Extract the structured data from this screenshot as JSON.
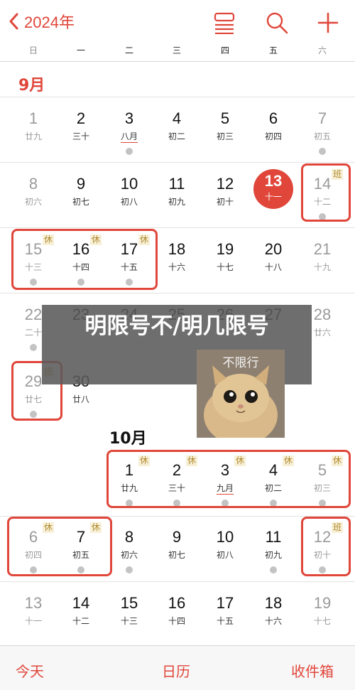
{
  "header": {
    "back_label": "2024年",
    "icons": [
      "list-view-icon",
      "search-icon",
      "add-icon"
    ]
  },
  "weekdays": [
    "日",
    "一",
    "二",
    "三",
    "四",
    "五",
    "六"
  ],
  "months": {
    "sep": {
      "label": "9月",
      "weeks": [
        [
          {
            "day": "1",
            "lunar": "廿九",
            "muted": true
          },
          {
            "day": "2",
            "lunar": "三十"
          },
          {
            "day": "3",
            "lunar": "八月",
            "underline": true,
            "dot": true
          },
          {
            "day": "4",
            "lunar": "初二"
          },
          {
            "day": "5",
            "lunar": "初三"
          },
          {
            "day": "6",
            "lunar": "初四"
          },
          {
            "day": "7",
            "lunar": "初五",
            "muted": true,
            "dot": true
          }
        ],
        [
          {
            "day": "8",
            "lunar": "初六",
            "muted": true
          },
          {
            "day": "9",
            "lunar": "初七"
          },
          {
            "day": "10",
            "lunar": "初八"
          },
          {
            "day": "11",
            "lunar": "初九"
          },
          {
            "day": "12",
            "lunar": "初十"
          },
          {
            "day": "13",
            "lunar": "十一",
            "today": true
          },
          {
            "day": "14",
            "lunar": "十二",
            "muted": true,
            "badge": "班",
            "dot": true
          }
        ],
        [
          {
            "day": "15",
            "lunar": "十三",
            "muted": true,
            "badge": "休",
            "dot": true
          },
          {
            "day": "16",
            "lunar": "十四",
            "badge": "休",
            "dot": true
          },
          {
            "day": "17",
            "lunar": "十五",
            "badge": "休",
            "dot": true
          },
          {
            "day": "18",
            "lunar": "十六"
          },
          {
            "day": "19",
            "lunar": "十七"
          },
          {
            "day": "20",
            "lunar": "十八"
          },
          {
            "day": "21",
            "lunar": "十九",
            "muted": true
          }
        ],
        [
          {
            "day": "22",
            "lunar": "二十",
            "muted": true,
            "dot": true
          },
          {
            "day": "23",
            "lunar": ""
          },
          {
            "day": "24",
            "lunar": ""
          },
          {
            "day": "25",
            "lunar": ""
          },
          {
            "day": "26",
            "lunar": ""
          },
          {
            "day": "27",
            "lunar": ""
          },
          {
            "day": "28",
            "lunar": "廿六",
            "muted": true
          }
        ],
        [
          {
            "day": "29",
            "lunar": "廿七",
            "muted": true,
            "badge": "班",
            "dot": true
          },
          {
            "day": "30",
            "lunar": "廿八"
          }
        ]
      ]
    },
    "oct": {
      "label": "10月",
      "weeks": [
        [
          null,
          null,
          {
            "day": "1",
            "lunar": "廿九",
            "badge": "休",
            "dot": true
          },
          {
            "day": "2",
            "lunar": "三十",
            "badge": "休",
            "dot": true
          },
          {
            "day": "3",
            "lunar": "九月",
            "underline": true,
            "badge": "休",
            "dot": true
          },
          {
            "day": "4",
            "lunar": "初二",
            "badge": "休",
            "dot": true
          },
          {
            "day": "5",
            "lunar": "初三",
            "muted": true,
            "badge": "休",
            "dot": true
          }
        ],
        [
          {
            "day": "6",
            "lunar": "初四",
            "muted": true,
            "badge": "休",
            "dot": true
          },
          {
            "day": "7",
            "lunar": "初五",
            "badge": "休",
            "dot": true
          },
          {
            "day": "8",
            "lunar": "初六",
            "dot": true
          },
          {
            "day": "9",
            "lunar": "初七"
          },
          {
            "day": "10",
            "lunar": "初八"
          },
          {
            "day": "11",
            "lunar": "初九",
            "dot": true
          },
          {
            "day": "12",
            "lunar": "初十",
            "muted": true,
            "badge": "班",
            "dot": true
          }
        ],
        [
          {
            "day": "13",
            "lunar": "十一",
            "muted": true
          },
          {
            "day": "14",
            "lunar": "十二"
          },
          {
            "day": "15",
            "lunar": "十三"
          },
          {
            "day": "16",
            "lunar": "十四"
          },
          {
            "day": "17",
            "lunar": "十五"
          },
          {
            "day": "18",
            "lunar": "十六"
          },
          {
            "day": "19",
            "lunar": "十七",
            "muted": true
          }
        ]
      ]
    }
  },
  "overlay": {
    "headline": "明限号不/明几限号",
    "image_caption": "不限行"
  },
  "tabbar": {
    "today": "今天",
    "calendars": "日历",
    "inbox": "收件箱"
  },
  "colors": {
    "accent": "#e0463a",
    "holiday_badge": "#b08a2e"
  }
}
